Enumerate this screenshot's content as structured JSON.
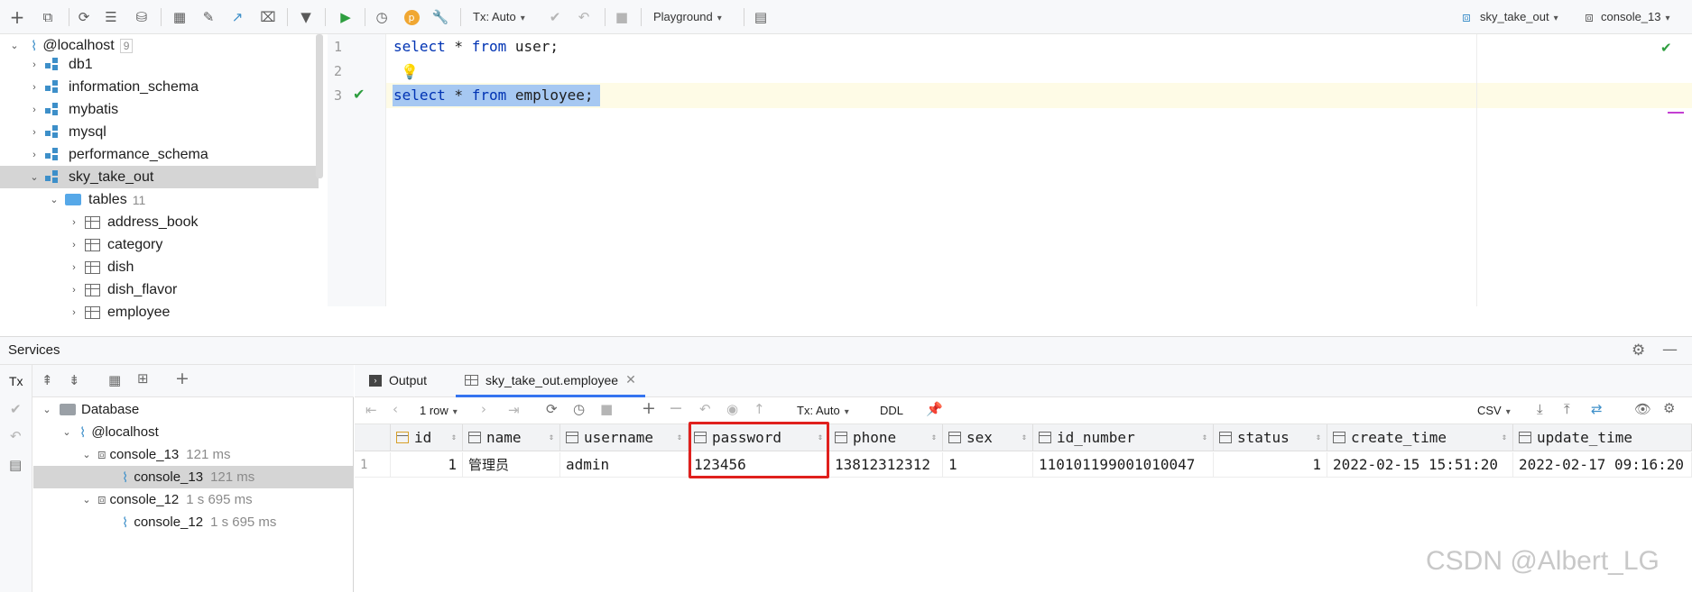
{
  "toolbar": {
    "tx_mode": "Tx: Auto",
    "playground": "Playground",
    "datasource": "sky_take_out",
    "console": "console_13"
  },
  "tree": {
    "root": {
      "label": "@localhost",
      "count": "9"
    },
    "items": [
      "db1",
      "information_schema",
      "mybatis",
      "mysql",
      "performance_schema",
      "sky_take_out"
    ],
    "tables_label": "tables",
    "tables_count": "11",
    "tables": [
      "address_book",
      "category",
      "dish",
      "dish_flavor",
      "employee"
    ]
  },
  "editor": {
    "lines": [
      {
        "num": "1",
        "kw1": "select",
        "mid": " * ",
        "kw2": "from",
        "rest": " user;"
      },
      {
        "num": "2"
      },
      {
        "num": "3",
        "kw1": "select",
        "mid": " * ",
        "kw2": "from",
        "rest": " employee;"
      }
    ]
  },
  "services": {
    "title": "Services",
    "tx_label": "Tx",
    "tree": [
      {
        "label": "Database",
        "ms": ""
      },
      {
        "label": "@localhost",
        "ms": ""
      },
      {
        "label": "console_13",
        "ms": "121 ms"
      },
      {
        "label": "console_13",
        "ms": "121 ms"
      },
      {
        "label": "console_12",
        "ms": "1 s 695 ms"
      },
      {
        "label": "console_12",
        "ms": "1 s 695 ms"
      }
    ]
  },
  "results": {
    "tab_output": "Output",
    "tab_table": "sky_take_out.employee",
    "rows_label": "1 row",
    "tx_mode": "Tx: Auto",
    "ddl": "DDL",
    "export": "CSV",
    "columns": [
      "id",
      "name",
      "username",
      "password",
      "phone",
      "sex",
      "id_number",
      "status",
      "create_time",
      "update_time"
    ],
    "row_num": "1",
    "row": [
      "1",
      "管理员",
      "admin",
      "123456",
      "13812312312",
      "1",
      "110101199001010047",
      "1",
      "2022-02-15 15:51:20",
      "2022-02-17 09:16:20"
    ]
  },
  "watermark": "CSDN @Albert_LG",
  "colors": {
    "accent": "#0033b3",
    "highlight": "#e0201d",
    "selection": "#a6c8f2"
  }
}
